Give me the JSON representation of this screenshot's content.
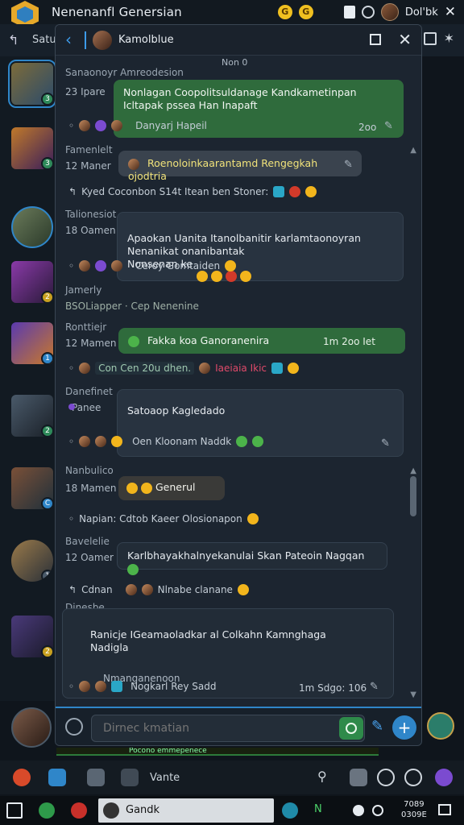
{
  "app": {
    "title": "Nenenanfl Genersian",
    "coins": [
      "G",
      "G"
    ],
    "user_name": "Dol'bk",
    "close_glyph": "✕"
  },
  "strip": {
    "back": "↰",
    "label": "Satu"
  },
  "chat": {
    "contact_name": "Kamolblue",
    "header_time": "Non 0",
    "messages": [
      {
        "sender": "Sanaonoyr Amreodesion",
        "time": "23 Ipare",
        "text": "Nonlagan Coopolitsuldanage Kandkametinpan Icltapak pssea Han Inapaft",
        "footer_names": "Danyarj Hapeil",
        "footer_time": "2oo"
      },
      {
        "sender": "Famenlelt",
        "time": "12 Maner",
        "text": "Roenoloinkaarantamd Rengegkah ojodtria",
        "react_label": "Kyed Coconbon S14t Itean ben Stoner:"
      },
      {
        "sender": "Talionesiot",
        "time": "18 Oamen",
        "text": "Apaokan Uanita Itanolbanitir karlamtaonoyran Nenanikat onanibantak\nNonsenan ke",
        "footer_names": "Ceroy Gomtaiden"
      },
      {
        "sender": "Jamerly",
        "sub": "BSOLiapper · Cep Nenenine"
      },
      {
        "sender": "Ronttiejr",
        "time": "12 Mamen",
        "text": "Fakka koa Ganoranenira",
        "meta_right": "1m 2oo Iet",
        "react_label": "Con Cen 20u dhen.",
        "react_label2": "Iaeiaia Ikic"
      },
      {
        "sender": "Danefinet",
        "time": "Panee",
        "text": "Satoaop Kagledado",
        "footer_names": "Oen Kloonam Naddk"
      },
      {
        "sender": "Nanbulico",
        "time": "18 Mamen",
        "text": "Generul",
        "react_label": "Napian: Cdtob Kaeer Olosionapon"
      },
      {
        "sender": "Bavelelie",
        "time": "12 Oamer",
        "text": "Karlbhayakhalnyekanulai Skan Pateoin Nagqan",
        "react_label": "Cdnan",
        "react_label2": "Nlnabe clanane"
      },
      {
        "sender": "Dinesbe",
        "text": "Ranicje IGeamaoladkar al Colkahn Kamnghaga\nNadigla",
        "sub": "Nmanganenoon",
        "footer_names": "Nogkarl Rey Sadd",
        "footer_time": "1m Sdgo: 106"
      }
    ],
    "composer_placeholder": "Dirnec kmatian"
  },
  "dock": {
    "search_label": "Vante"
  },
  "taskbar": {
    "active_label": "Gandk",
    "tray_text": "N ",
    "clock_line1": "7089",
    "clock_line2": "0309E"
  },
  "greenline_text": "Pocono emmepenece"
}
